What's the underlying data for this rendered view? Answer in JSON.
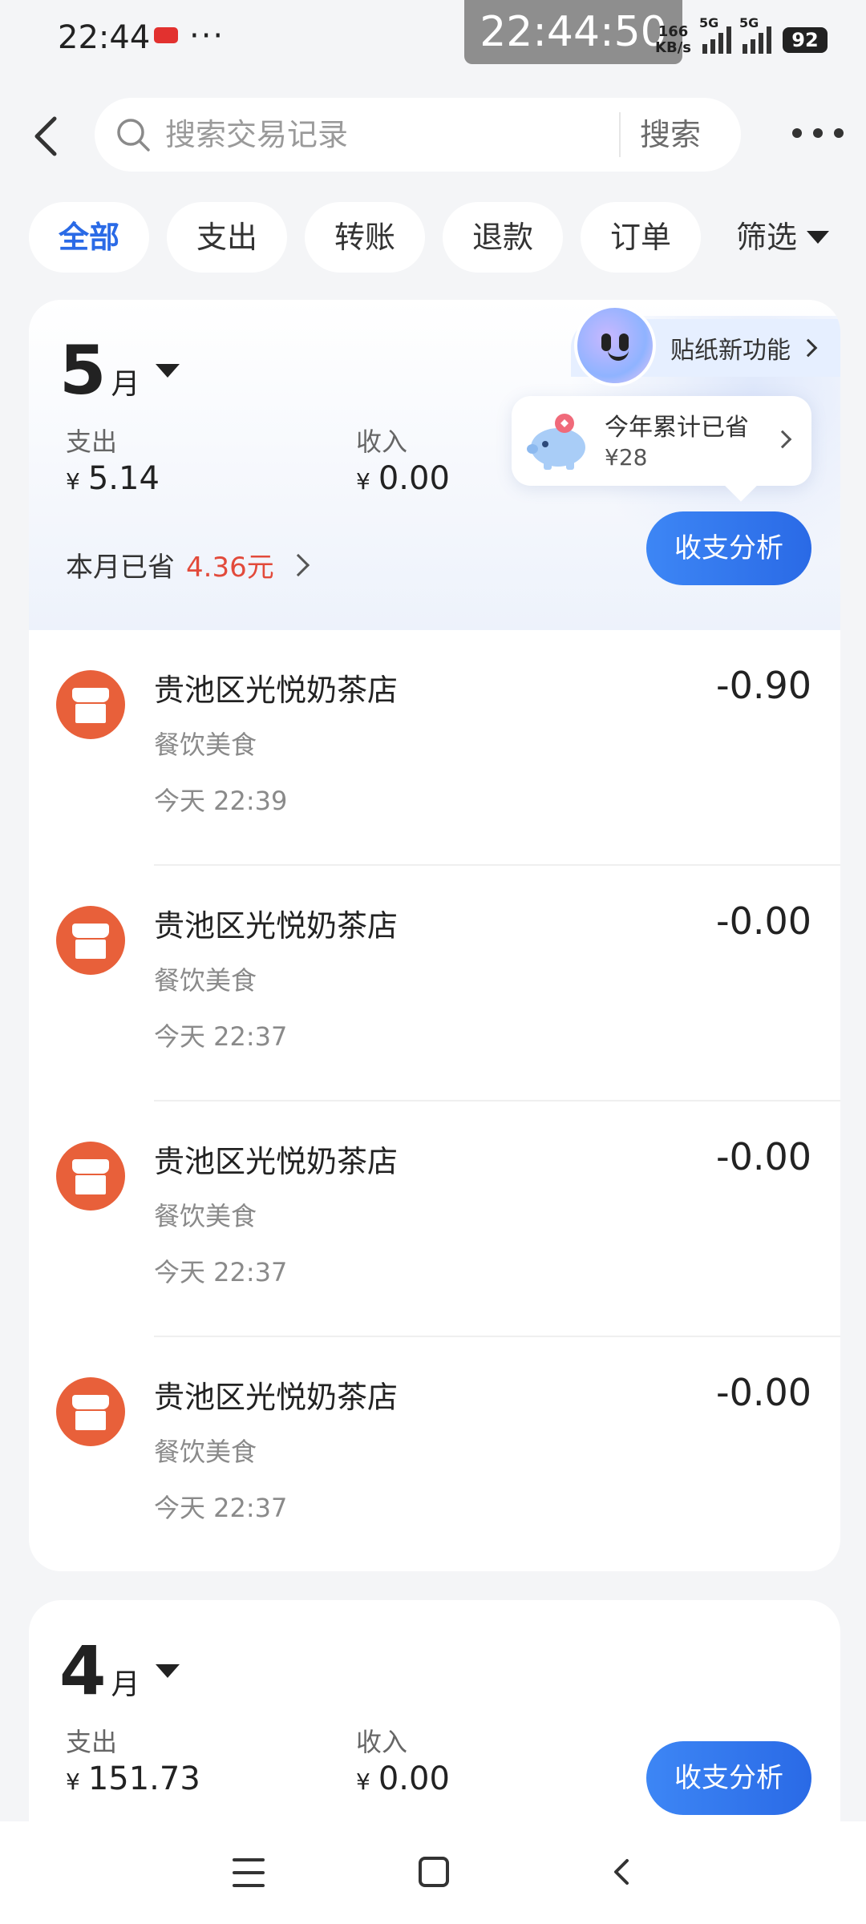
{
  "status_bar": {
    "time": "22:44",
    "more": "···",
    "clock_overlay": "22:44:50",
    "net_speed_value": "166",
    "net_speed_unit": "KB/s",
    "signal1_label": "5G",
    "signal2_label": "5G",
    "battery": "92"
  },
  "header": {
    "search_placeholder": "搜索交易记录",
    "search_button": "搜索"
  },
  "tabs": [
    {
      "label": "全部",
      "active": true
    },
    {
      "label": "支出",
      "active": false
    },
    {
      "label": "转账",
      "active": false
    },
    {
      "label": "退款",
      "active": false
    },
    {
      "label": "订单",
      "active": false
    }
  ],
  "filter_label": "筛选",
  "sticker": {
    "label": "贴纸新功能"
  },
  "savings_bubble": {
    "title": "今年累计已省",
    "amount": "¥28"
  },
  "months": [
    {
      "month": "5",
      "unit": "月",
      "expense_label": "支出",
      "expense_currency": "¥",
      "expense_value": "5.14",
      "income_label": "收入",
      "income_currency": "¥",
      "income_value": "0.00",
      "saved_label": "本月已省",
      "saved_amount": "4.36元",
      "analysis_button": "收支分析",
      "transactions": [
        {
          "name": "贵池区光悦奶茶店",
          "category": "餐饮美食",
          "time": "今天 22:39",
          "amount": "-0.90"
        },
        {
          "name": "贵池区光悦奶茶店",
          "category": "餐饮美食",
          "time": "今天 22:37",
          "amount": "-0.00"
        },
        {
          "name": "贵池区光悦奶茶店",
          "category": "餐饮美食",
          "time": "今天 22:37",
          "amount": "-0.00"
        },
        {
          "name": "贵池区光悦奶茶店",
          "category": "餐饮美食",
          "time": "今天 22:37",
          "amount": "-0.00"
        }
      ]
    },
    {
      "month": "4",
      "unit": "月",
      "expense_label": "支出",
      "expense_currency": "¥",
      "expense_value": "151.73",
      "income_label": "收入",
      "income_currency": "¥",
      "income_value": "0.00",
      "analysis_button": "收支分析"
    }
  ],
  "colors": {
    "accent": "#2a6ae6",
    "saved_red": "#e24a3b",
    "store_icon": "#e8603a"
  },
  "icons": [
    "back-arrow-icon",
    "search-icon",
    "more-dots-icon",
    "triangle-down-icon",
    "chevron-right-icon",
    "piggy-bank-icon",
    "store-icon",
    "nav-menu-icon",
    "nav-home-icon",
    "nav-back-icon"
  ]
}
